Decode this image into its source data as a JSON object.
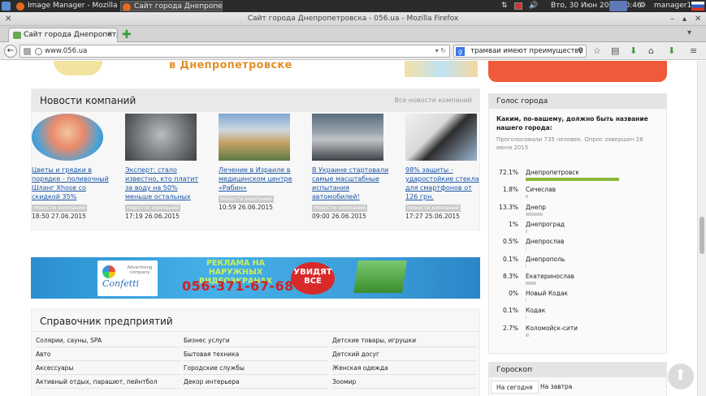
{
  "taskbar": {
    "tasks": [
      "Image Manager - Mozilla Fi...",
      "Сайт города Днепропетр..."
    ],
    "clock": "Втo, 30 Июн 2015 10:46",
    "user": "manager12"
  },
  "window": {
    "title": "Сайт города Днепропетровска - 056.ua - Mozilla Firefox"
  },
  "tab": {
    "label": "Сайт города Днепропетр..."
  },
  "navbar": {
    "url": "www.056.ua",
    "search_value": "трамваи имеют преимущество"
  },
  "top_banner": {
    "text": "в Днепропетровске"
  },
  "company_news": {
    "title": "Новости компаний",
    "all_link": "Все новости компаний",
    "tag": "Новости компаний",
    "items": [
      {
        "title": "Цветы и грядки в порядке - поливочный Шланг Xhose со скидкой 35%",
        "date": "18:50  27.06.2015"
      },
      {
        "title": "Эксперт: стало известно, кто платит за воду на 50% меньше остальных",
        "date": "17:19  26.06.2015"
      },
      {
        "title": "Лечение в Израиле в медицинском центре «Рабин»",
        "date": "10:59  26.06.2015"
      },
      {
        "title": "В Украине стартовали самые масштабные испытания автомобилей!",
        "date": "09:00  26.06.2015"
      },
      {
        "title": "98% защиты - ударостойкие стекла для смартфонов от 126 грн.",
        "date": "17:27  25.06.2015"
      }
    ]
  },
  "ad": {
    "company_small": "Advertising company",
    "company": "Confetti",
    "headline": "РЕКЛАМА НА НАРУЖНЫХ ВИДЕОЭКРАНАХ",
    "phone": "056-371-67-68",
    "cta": "УВИДЯТ ВСЕ"
  },
  "directory": {
    "title": "Справочник предприятий",
    "col1": [
      "Солярии, сауны, SPA",
      "Авто",
      "Аксессуары",
      "Активный отдых, парашют, пейнтбол"
    ],
    "col2": [
      "Бизнес услуги",
      "Бытовая техника",
      "Городские службы",
      "Декор интерьера"
    ],
    "col3": [
      "Детские товары, игрушки",
      "Детский досуг",
      "Женская одежда",
      "Зоомир"
    ]
  },
  "poll": {
    "title": "Голос города",
    "question": "Каким, по-вашему, должно быть название нашего города:",
    "meta": "Проголосовали 735 человек. Опрос завершен 28 июня 2015",
    "options": [
      {
        "pct": "72.1%",
        "name": "Днепропетровск",
        "value": 72.1
      },
      {
        "pct": "1.8%",
        "name": "Сичеслав",
        "value": 1.8
      },
      {
        "pct": "13.3%",
        "name": "Днепр",
        "value": 13.3
      },
      {
        "pct": "1%",
        "name": "Днепроград",
        "value": 1
      },
      {
        "pct": "0.5%",
        "name": "Днепрослав",
        "value": 0.5
      },
      {
        "pct": "0.1%",
        "name": "Днепрополь",
        "value": 0.1
      },
      {
        "pct": "8.3%",
        "name": "Екатеринослав",
        "value": 8.3
      },
      {
        "pct": "0%",
        "name": "Новый Кодак",
        "value": 0
      },
      {
        "pct": "0.1%",
        "name": "Кодак",
        "value": 0.1
      },
      {
        "pct": "2.7%",
        "name": "Коломойск-сити",
        "value": 2.7
      }
    ]
  },
  "horoscope": {
    "title": "Гороскоп",
    "tabs": [
      "На сегодня",
      "На завтра"
    ]
  },
  "colors": {
    "poll_bar": "#8cb83c",
    "poll_bar_minor": "#cfcfcf",
    "link": "#1a55a8"
  }
}
